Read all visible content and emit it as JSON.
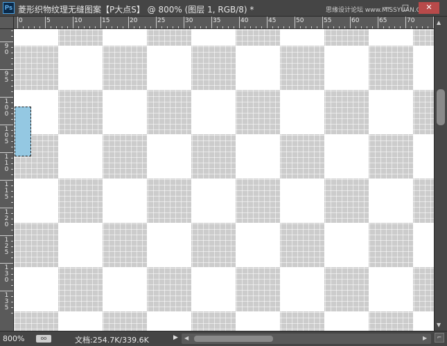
{
  "window": {
    "app_icon": "Ps",
    "title": "菱形织物纹理无缝图案【P大点S】 @ 800% (图层 1, RGB/8) *",
    "watermark": "思缘设计论坛 www.MISSYUAN.COM",
    "controls": {
      "minimize": "—",
      "maximize": "□",
      "close": "✕"
    }
  },
  "ruler": {
    "horizontal": [
      "0",
      "5",
      "10",
      "15",
      "20",
      "25",
      "30",
      "35",
      "40",
      "45",
      "50",
      "55",
      "60",
      "65",
      "70"
    ],
    "vertical": [
      "85",
      "90",
      "95",
      "100",
      "105",
      "110",
      "115",
      "120",
      "125",
      "130",
      "135"
    ]
  },
  "canvas": {
    "pattern": "checkerboard",
    "colors": {
      "light": "#ffffff",
      "dark": "#cccccc",
      "selection_fill": "#94c8e2"
    }
  },
  "statusbar": {
    "zoom": "800%",
    "doc_size": "文档:254.7K/339.6K",
    "icons": {
      "status": "glasses-icon",
      "arrow": "triangle-right-icon"
    }
  },
  "colors": {
    "chrome_bg": "#3c3c3c",
    "titlebar": "#454545",
    "ruler": "#5a5a5a",
    "close_button": "#b84a4a"
  }
}
